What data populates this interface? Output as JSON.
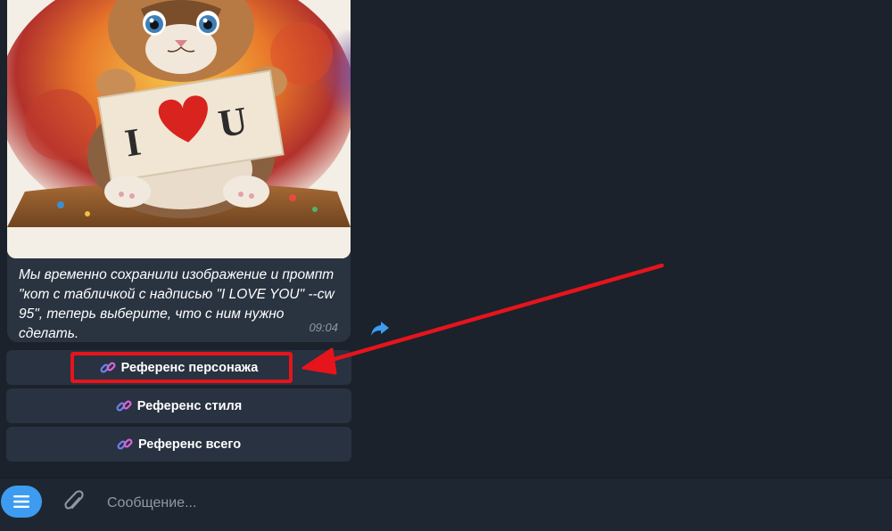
{
  "message": {
    "caption": "Мы временно сохранили изображение и промпт \"кот с табличкой с надписью \"I LOVE YOU\" --cw 95\", теперь выберите, что с ним нужно сделать.",
    "time": "09:04",
    "image": {
      "description_icon": "kitten-illustration",
      "sign_text_left": "I",
      "sign_text_right": "U"
    }
  },
  "keyboard": {
    "buttons": [
      {
        "icon": "link-chain-icon",
        "label": "Референс персонажа"
      },
      {
        "icon": "link-chain-icon",
        "label": "Референс стиля"
      },
      {
        "icon": "link-chain-icon",
        "label": "Референс всего"
      }
    ]
  },
  "input": {
    "placeholder": "Сообщение..."
  },
  "colors": {
    "background": "#1b222c",
    "bubble": "#2a3441",
    "button": "#283240",
    "accent": "#3d9cf0",
    "annotation": "#e6141b"
  }
}
